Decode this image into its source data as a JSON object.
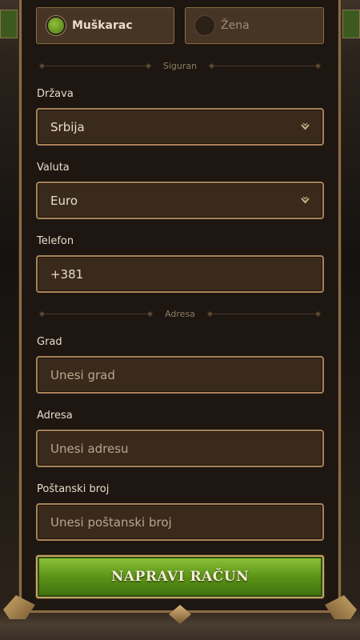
{
  "gender": {
    "male_label": "Muškarac",
    "female_label": "Žena",
    "selected": "male"
  },
  "sections": {
    "security": "Siguran",
    "address": "Adresa"
  },
  "fields": {
    "country": {
      "label": "Država",
      "value": "Srbija"
    },
    "currency": {
      "label": "Valuta",
      "value": "Euro"
    },
    "phone": {
      "label": "Telefon",
      "value": "+381"
    },
    "city": {
      "label": "Grad",
      "placeholder": "Unesi grad"
    },
    "address": {
      "label": "Adresa",
      "placeholder": "Unesi adresu"
    },
    "postal": {
      "label": "Poštanski broj",
      "placeholder": "Unesi poštanski broj"
    }
  },
  "submit_label": "NAPRAVI RAČUN",
  "icons": {
    "dropdown": "chevron-down-icon",
    "radio_on": "radio-selected-icon",
    "radio_off": "radio-unselected-icon"
  },
  "colors": {
    "accent_green": "#5c9418",
    "frame_gold": "#a88358",
    "panel_bg": "#1d1611"
  }
}
